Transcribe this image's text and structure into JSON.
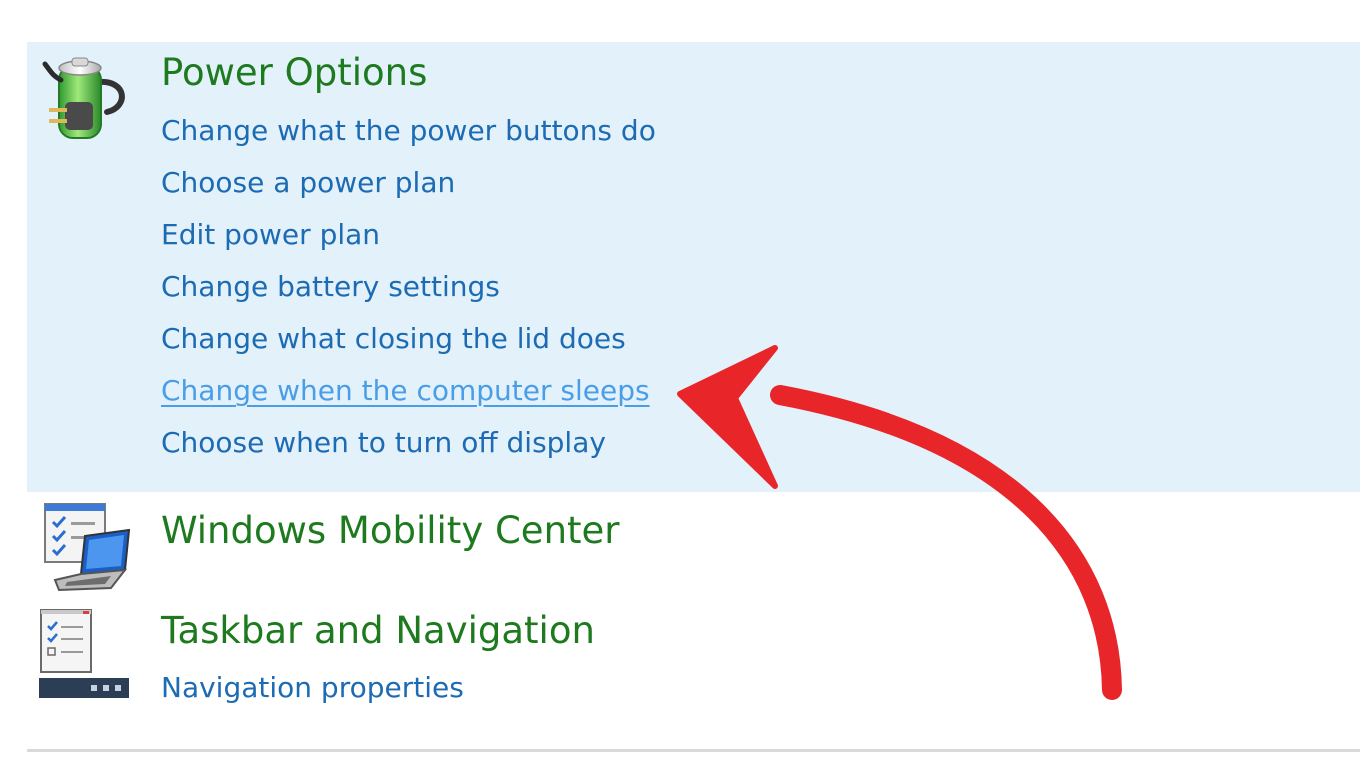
{
  "sections": [
    {
      "title": "Power Options",
      "icon": "battery-plug-icon",
      "links": [
        "Change what the power buttons do",
        "Choose a power plan",
        "Edit power plan",
        "Change battery settings",
        "Change what closing the lid does",
        "Change when the computer sleeps",
        "Choose when to turn off display"
      ]
    },
    {
      "title": "Windows Mobility Center",
      "icon": "laptop-checklist-icon",
      "links": []
    },
    {
      "title": "Taskbar and Navigation",
      "icon": "taskbar-checklist-icon",
      "links": [
        "Navigation properties"
      ]
    }
  ],
  "colors": {
    "title": "#1e7a1e",
    "link": "#1c6bb3",
    "link_hover": "#4a9ee8",
    "highlight_bg": "#e3f1fb",
    "annotation_arrow": "#e8262a"
  },
  "annotation": {
    "type": "curved-arrow",
    "target": "Change when the computer sleeps"
  }
}
